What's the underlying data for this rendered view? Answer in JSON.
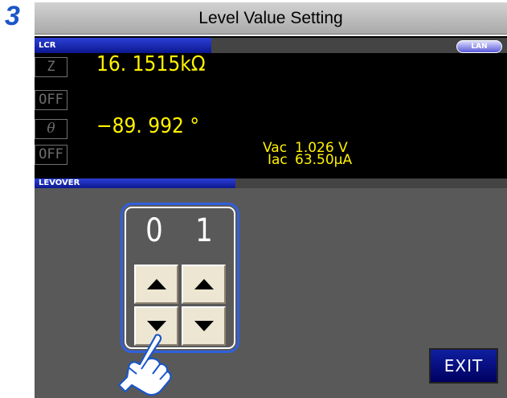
{
  "step_number": "3",
  "title": "Level Value Setting",
  "top_section": {
    "tag": "LCR",
    "lan_badge": "LAN",
    "params": [
      {
        "label": "Z",
        "value": "16. 1515kΩ"
      },
      {
        "label": "OFF"
      },
      {
        "label": "θ",
        "value": "−89. 992 °"
      },
      {
        "label": "OFF"
      }
    ],
    "monitor": {
      "vac_label": "Vac",
      "vac_value": "1.026 V",
      "iac_label": "Iac",
      "iac_value": "63.50μA"
    }
  },
  "lower_section": {
    "tag": "LEVOVER",
    "digits": [
      "0",
      "1"
    ],
    "exit_label": "EXIT"
  },
  "colors": {
    "accent_blue": "#3060e0",
    "value_yellow": "#fff200",
    "step_blue": "#1a56c8"
  },
  "icons": [
    "up-arrow-icon",
    "down-arrow-icon",
    "pointing-hand-icon"
  ]
}
